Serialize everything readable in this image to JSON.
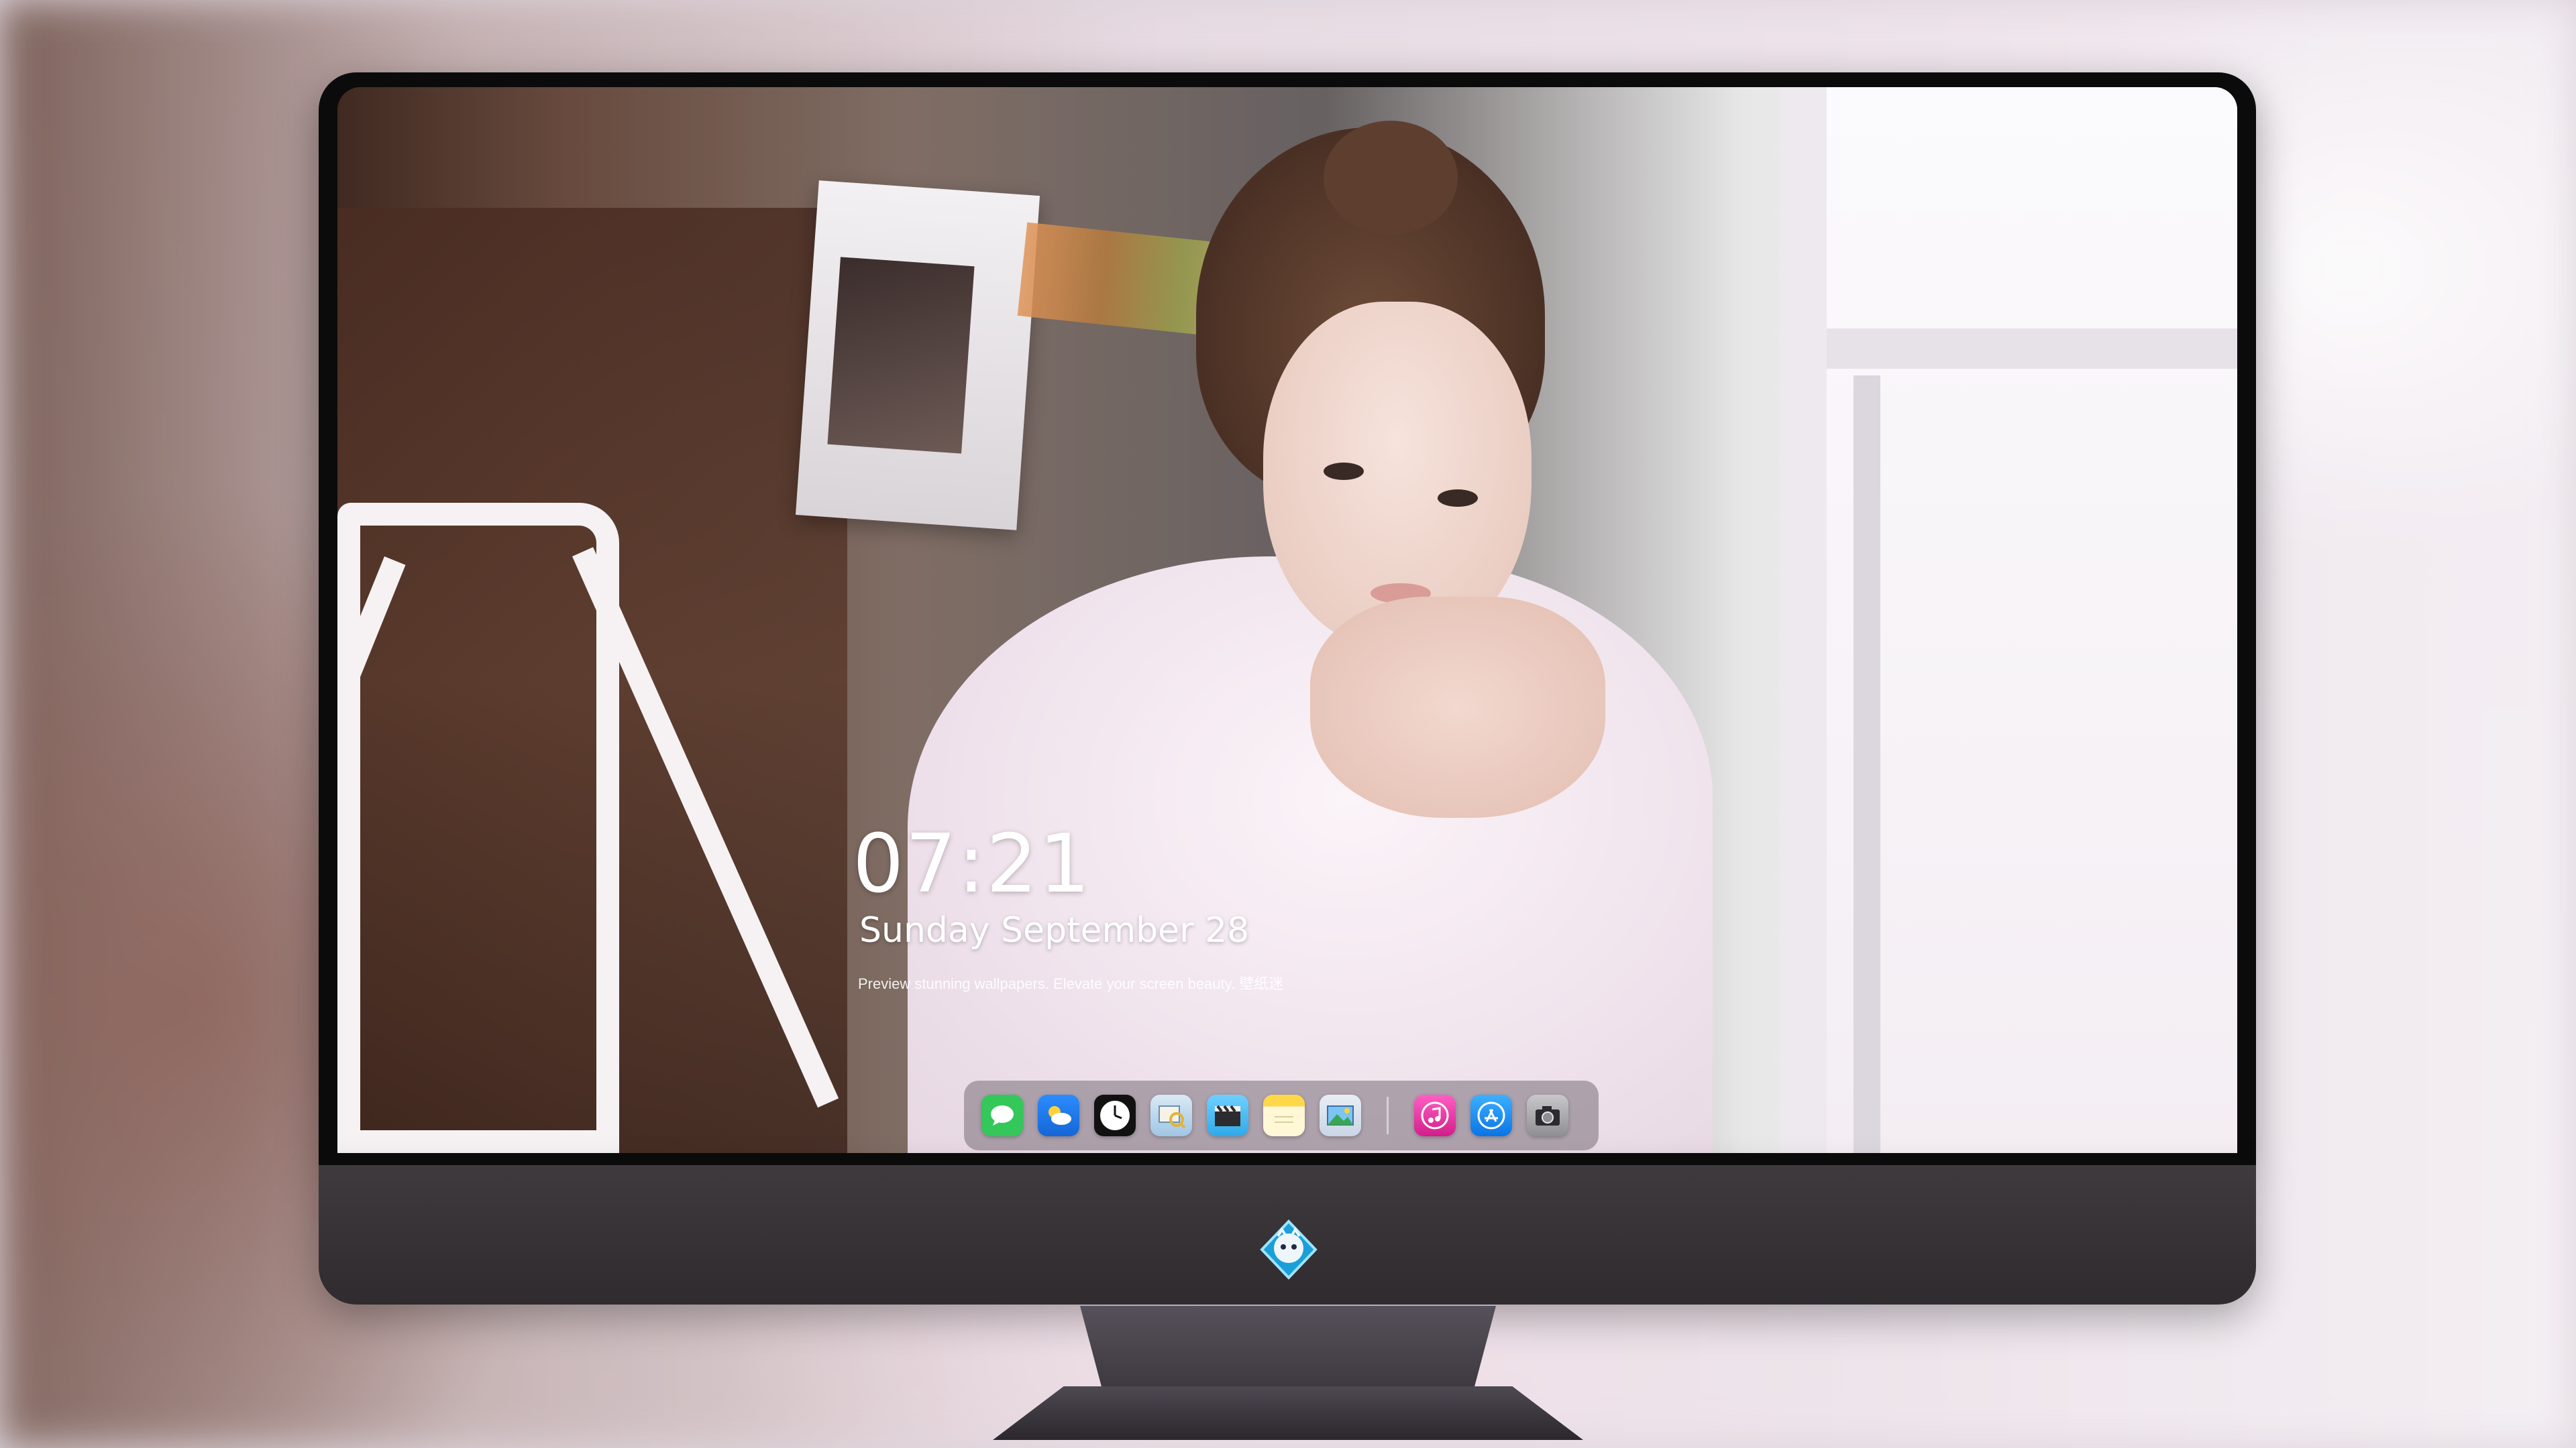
{
  "lockscreen": {
    "time": "07:21",
    "date": "Sunday September  28",
    "tagline": "Preview stunning wallpapers. Elevate your screen beauty. 壁纸迷"
  },
  "dock": {
    "apps": [
      {
        "name": "Messages",
        "icon": "messages-icon"
      },
      {
        "name": "Weather",
        "icon": "weather-icon"
      },
      {
        "name": "Clock",
        "icon": "clock-icon"
      },
      {
        "name": "Preview",
        "icon": "preview-icon"
      },
      {
        "name": "Video",
        "icon": "clapperboard-icon"
      },
      {
        "name": "Notes",
        "icon": "notes-icon"
      },
      {
        "name": "Photo Viewer",
        "icon": "photo-viewer-icon"
      },
      {
        "name": "Music",
        "icon": "music-icon"
      },
      {
        "name": "App Store",
        "icon": "app-store-icon"
      },
      {
        "name": "Camera",
        "icon": "camera-icon"
      }
    ]
  },
  "colors": {
    "bezel": "#0b0b0c",
    "chin": "#3f3a3d",
    "dock_bg": "rgba(120,110,120,0.55)",
    "messages": "#34c759",
    "weather": "#1e90ff",
    "music": "#ff3ba0",
    "appstore": "#1a8cff"
  }
}
